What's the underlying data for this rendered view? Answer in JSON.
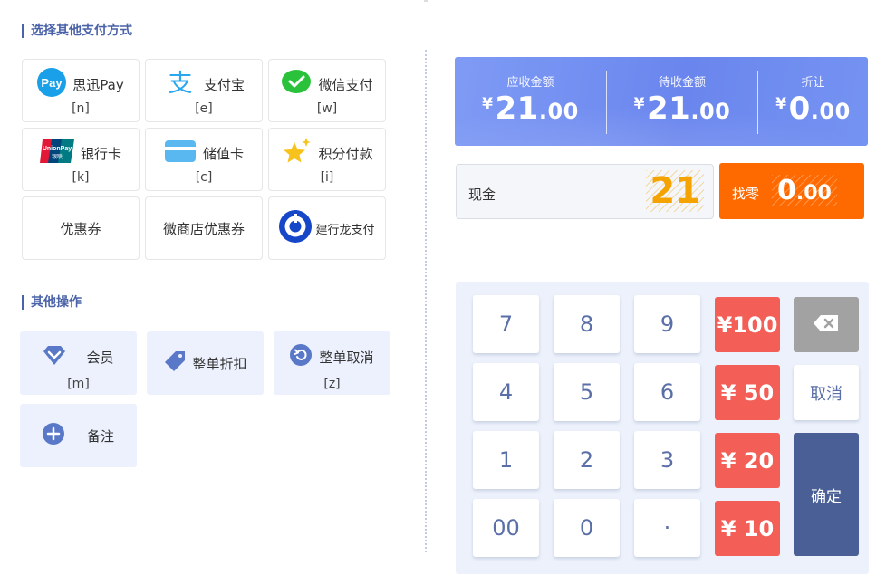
{
  "pay_section": {
    "title": "选择其他支付方式"
  },
  "pay_methods": [
    {
      "label": "思迅Pay",
      "key": "[n]",
      "icon": "sixun-pay-icon"
    },
    {
      "label": "支付宝",
      "key": "[e]",
      "icon": "alipay-icon"
    },
    {
      "label": "微信支付",
      "key": "[w]",
      "icon": "wechat-pay-icon"
    },
    {
      "label": "银行卡",
      "key": "[k]",
      "icon": "unionpay-icon"
    },
    {
      "label": "储值卡",
      "key": "[c]",
      "icon": "stored-card-icon"
    },
    {
      "label": "积分付款",
      "key": "[i]",
      "icon": "points-star-icon"
    },
    {
      "label": "优惠券"
    },
    {
      "label": "微商店优惠券"
    },
    {
      "label": "建行龙支付",
      "icon": "ccb-long-pay-icon"
    }
  ],
  "ops_section": {
    "title": "其他操作"
  },
  "operations": [
    {
      "label": "会员",
      "key": "[m]",
      "icon": "member-diamond-icon"
    },
    {
      "label": "整单折扣",
      "icon": "discount-tag-icon"
    },
    {
      "label": "整单取消",
      "key": "[z]",
      "icon": "undo-circle-icon"
    },
    {
      "label": "备注",
      "icon": "plus-circle-icon"
    }
  ],
  "summary": {
    "receivable": {
      "label": "应收金额",
      "currency": "¥",
      "int": "21",
      "dec": ".00"
    },
    "pending": {
      "label": "待收金额",
      "currency": "¥",
      "int": "21",
      "dec": ".00"
    },
    "discount": {
      "label": "折让",
      "currency": "¥",
      "int": "0",
      "dec": ".00"
    }
  },
  "cash": {
    "label": "现金",
    "value": "21"
  },
  "change": {
    "label": "找零",
    "int": "0",
    "dec": ".00"
  },
  "keypad": {
    "digits": [
      "7",
      "8",
      "9",
      "4",
      "5",
      "6",
      "1",
      "2",
      "3",
      "00",
      "0",
      "·"
    ],
    "money": [
      "¥100",
      "¥ 50",
      "¥ 20",
      "¥ 10"
    ],
    "cancel": "取消",
    "confirm": "确定",
    "backspace_icon": "backspace-icon"
  },
  "colors": {
    "accent": "#4a62a8",
    "summary_bg": "#7390f1",
    "cash_value": "#f5a300",
    "change_bg": "#ff6a00",
    "money_key": "#f35f56",
    "confirm_key": "#4a5f95",
    "keypad_bg": "#ecf1fb"
  }
}
